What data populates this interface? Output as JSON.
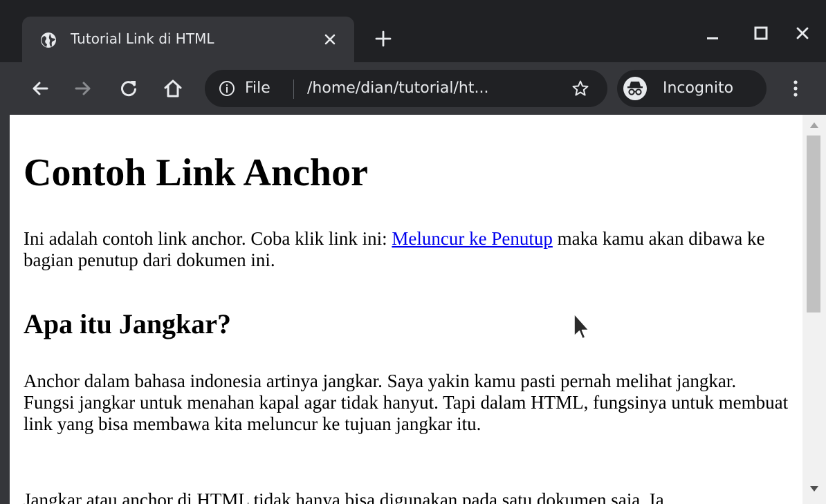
{
  "tab": {
    "title": "Tutorial Link di HTML",
    "favicon": "globe-icon"
  },
  "toolbar": {
    "scheme_label": "File",
    "url": "/home/dian/tutorial/ht...",
    "incognito_label": "Incognito"
  },
  "content": {
    "heading": "Contoh Link Anchor",
    "p1_before": "Ini adalah contoh link anchor. Coba klik link ini: ",
    "p1_link": "Meluncur ke Penutup",
    "p1_after": " maka kamu akan dibawa ke bagian penutup dari dokumen ini.",
    "subheading": "Apa itu Jangkar?",
    "p2": "Anchor dalam bahasa indonesia artinya jangkar. Saya yakin kamu pasti pernah melihat jangkar. Fungsi jangkar untuk menahan kapal agar tidak hanyut. Tapi dalam HTML, fungsinya untuk membuat link yang bisa membawa kita meluncur ke tujuan jangkar itu.",
    "p3": "Jangkar atau anchor di HTML tidak hanya bisa digunakan pada satu dokumen saja. Ia"
  },
  "colors": {
    "tabstrip_bg": "#202124",
    "active_tab_bg": "#35363a",
    "omnibox_bg": "#202124",
    "text_light": "#e8eaed",
    "link": "#0000ee"
  }
}
